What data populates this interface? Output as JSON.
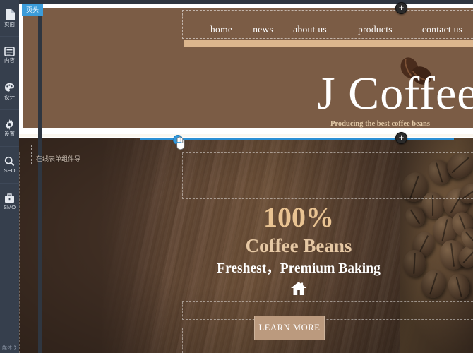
{
  "sidebar": {
    "items": [
      {
        "label": "页面",
        "icon": "page-icon"
      },
      {
        "label": "内容",
        "icon": "content-icon"
      },
      {
        "label": "设计",
        "icon": "palette-icon"
      },
      {
        "label": "设置",
        "icon": "gear-icon"
      },
      {
        "label": "SEO",
        "icon": "search-icon"
      },
      {
        "label": "SMO",
        "icon": "briefcase-icon"
      }
    ],
    "bottom": {
      "label": "媒体",
      "chevron": "❯"
    }
  },
  "overlay": {
    "header_tab_label": "页头",
    "plus_label": "+",
    "accent_blue": "#3b9cd9"
  },
  "site": {
    "nav": [
      {
        "label": "home"
      },
      {
        "label": "news"
      },
      {
        "label": "about us"
      },
      {
        "label": "products"
      },
      {
        "label": "contact us"
      }
    ],
    "logo_text": "J Coffee",
    "tagline": "Producing the best coffee beans",
    "hero": {
      "percent": "100%",
      "subject": "Coffee Beans",
      "slogan": "Freshest，Premium Baking",
      "cta_label": "LEARN MORE",
      "home_icon": "home-icon"
    },
    "annotation": "在线表单组件导"
  },
  "colors": {
    "header_brown": "#7b5c45",
    "hero_brown": "#4a382b",
    "accent_tan": "#dcb68d",
    "cta_bg": "#bb9a7e",
    "gold_text": "#e9c392",
    "sidebar_bg": "#363f4d"
  }
}
